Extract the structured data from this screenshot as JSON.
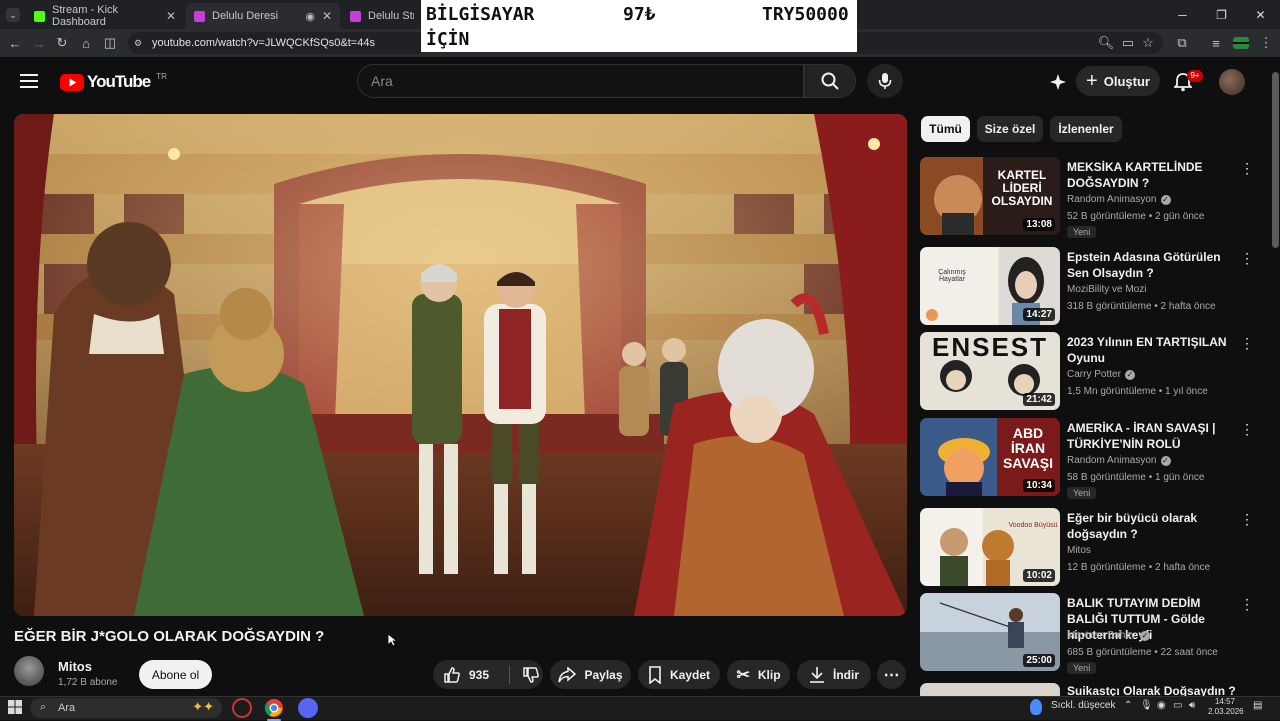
{
  "browser": {
    "tabs": [
      {
        "label": "Stream - Kick Dashboard",
        "color": "#53fc18"
      },
      {
        "label": "Delulu Deresi",
        "color": "#c63dd8"
      },
      {
        "label": "Delulu Stream",
        "color": "#c63dd8"
      }
    ],
    "url": "youtube.com/watch?v=JLWQCKfSQs0&t=44s"
  },
  "overlay": {
    "label1": "BİLGİSAYAR",
    "label2": "İÇİN",
    "price": "97₺",
    "goal": "TRY50000"
  },
  "header": {
    "logo_text": "YouTube",
    "region": "TR",
    "search_placeholder": "Ara",
    "create_label": "Oluştur",
    "notification_count": "9+"
  },
  "video": {
    "title": "EĞER BİR J*GOLO OLARAK DOĞSAYDIN ?",
    "channel": "Mitos",
    "subscribers": "1,72 B abone",
    "subscribe_label": "Abone ol",
    "likes": "935",
    "share_label": "Paylaş",
    "save_label": "Kaydet",
    "clip_label": "Klip",
    "download_label": "İndir"
  },
  "chips": [
    "Tümü",
    "Size özel",
    "İzlenenler"
  ],
  "recommendations": [
    {
      "title": "MEKSİKA KARTELİNDE DOĞSAYDIN ?",
      "channel": "Random Animasyon",
      "verified": true,
      "meta": "52 B görüntüleme • 2 gün önce",
      "duration": "13:08",
      "badge": "Yeni",
      "thumb_text": "KARTEL LİDERİ OLSAYDIN"
    },
    {
      "title": "Epstein Adasına Götürülen Sen Olsaydın ?",
      "channel": "MoziBility ve Mozi",
      "verified": false,
      "meta": "318 B görüntüleme • 2 hafta önce",
      "duration": "14:27",
      "badge": "",
      "thumb_text": "Çalınmış Hayatlar"
    },
    {
      "title": "2023 Yılının EN TARTIŞILAN Oyunu",
      "channel": "Carry Potter",
      "verified": true,
      "meta": "1,5 Mn görüntüleme • 1 yıl önce",
      "duration": "21:42",
      "badge": "",
      "thumb_text": "ENSEST"
    },
    {
      "title": "AMERİKA - İRAN SAVAŞI | TÜRKİYE'NİN ROLÜ",
      "channel": "Random Animasyon",
      "verified": true,
      "meta": "58 B görüntüleme • 1 gün önce",
      "duration": "10:34",
      "badge": "Yeni",
      "thumb_text": "ABD İRAN SAVAŞI"
    },
    {
      "title": "Eğer bir büyücü olarak doğsaydın ?",
      "channel": "Mitos",
      "verified": false,
      "meta": "12 B görüntüleme • 2 hafta önce",
      "duration": "10:02",
      "badge": "",
      "thumb_text": "Voodoo Büyüsü"
    },
    {
      "title": "BALIK TUTAYIM DEDİM BALIĞI TUTTUM - Gölde hipotermi keyfi",
      "channel": "Mevtcan Bahav",
      "verified": true,
      "meta": "685 B görüntüleme • 22 saat önce",
      "duration": "25:00",
      "badge": "Yeni",
      "thumb_text": ""
    },
    {
      "title": "Suikastçı Olarak Doğsaydın ?",
      "channel": "",
      "verified": false,
      "meta": "",
      "duration": "",
      "badge": "",
      "thumb_text": ""
    }
  ],
  "taskbar": {
    "search": "Ara",
    "weather": "Sıckl. düşecek",
    "time": "14:57",
    "date": "2.03.2026"
  }
}
